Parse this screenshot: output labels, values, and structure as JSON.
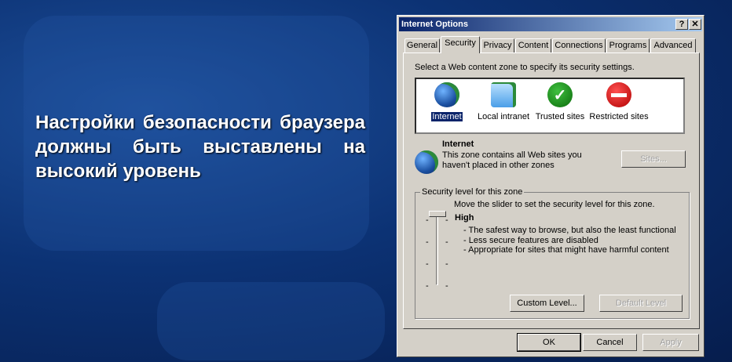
{
  "slide": {
    "text": "Настройки безопасности браузера должны быть выставлены на высокий уровень"
  },
  "dialog": {
    "title": "Internet Options",
    "help_label": "?",
    "close_label": "✕",
    "tabs": [
      "General",
      "Security",
      "Privacy",
      "Content",
      "Connections",
      "Programs",
      "Advanced"
    ],
    "active_tab": "Security",
    "zone_prompt": "Select a Web content zone to specify its security settings.",
    "zones": [
      {
        "label": "Internet",
        "icon": "globe-icon"
      },
      {
        "label": "Local intranet",
        "icon": "intranet-icon"
      },
      {
        "label": "Trusted sites",
        "icon": "checkmark-icon"
      },
      {
        "label": "Restricted sites",
        "icon": "no-entry-icon"
      }
    ],
    "selected_zone": {
      "name": "Internet",
      "description": "This zone contains all Web sites you haven't placed in other zones"
    },
    "sites_label": "Sites...",
    "group_label": "Security level for this zone",
    "slider_hint": "Move the slider to set the security level for this zone.",
    "level": {
      "name": "High",
      "position": "4 of 4",
      "bullets": [
        "- The safest way to browse, but also the least functional",
        "- Less secure features are disabled",
        "- Appropriate for sites that might have harmful content"
      ]
    },
    "custom_level_label": "Custom Level...",
    "default_level_label": "Default Level",
    "ok_label": "OK",
    "cancel_label": "Cancel",
    "apply_label": "Apply"
  }
}
